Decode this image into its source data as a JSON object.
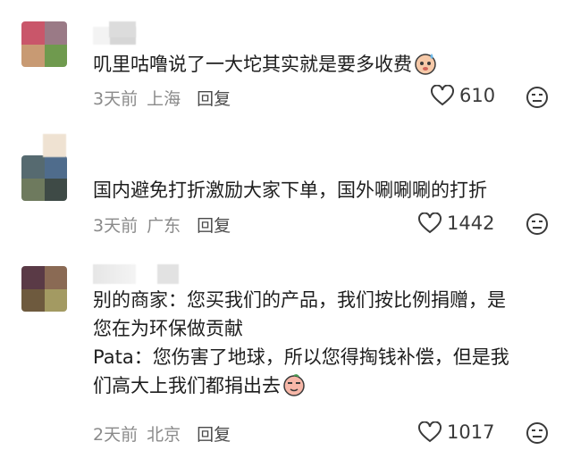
{
  "comments": [
    {
      "text_lines": [
        "叽里咕噜说了一大坨其实就是要多收费"
      ],
      "time": "3天前",
      "location": "上海",
      "reply_label": "回复",
      "likes": "610",
      "emoji": "sweat-face-icon",
      "avatar_colors": [
        "#c9566a",
        "#9a7a86",
        "#c89a73",
        "#6f9a4e"
      ]
    },
    {
      "text_lines": [
        "国内避免打折激励大家下单，国外唰唰唰的打折"
      ],
      "time": "3天前",
      "location": "广东",
      "reply_label": "回复",
      "likes": "1442",
      "avatar_colors": [
        "#566a70",
        "#4f6c8c",
        "#6e7a5e",
        "#3e4a46"
      ]
    },
    {
      "text_lines": [
        "别的商家：您买我们的产品，我们按比例捐赠，是",
        "您在为环保做贡献",
        "Pata：您伤害了地球，所以您得掏钱补偿，但是我",
        "们高大上我们都捐出去"
      ],
      "time": "2天前",
      "location": "北京",
      "reply_label": "回复",
      "likes": "1017",
      "emoji": "smirk-peach-icon",
      "avatar_colors": [
        "#5a3a46",
        "#8a6a54",
        "#6e5a3e",
        "#a39a62"
      ]
    }
  ]
}
